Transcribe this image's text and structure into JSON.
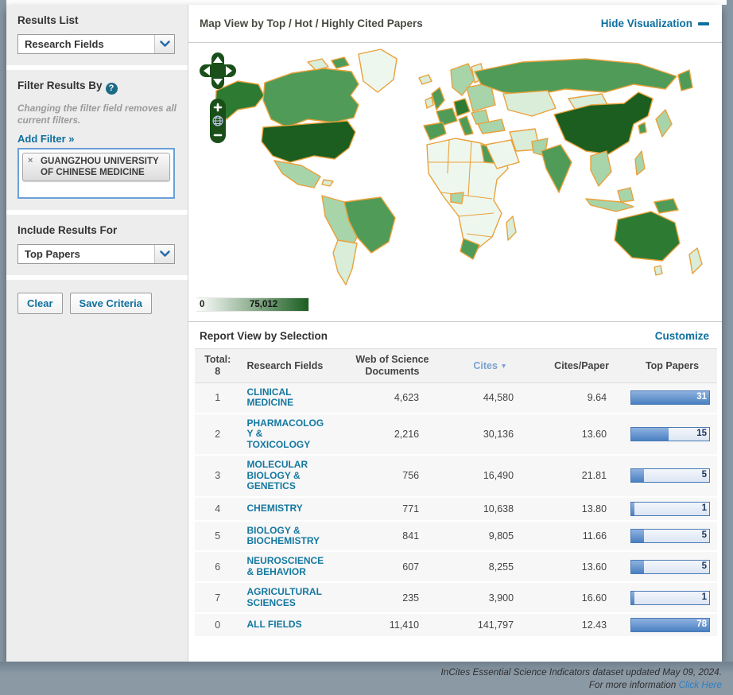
{
  "colors": {
    "link": "#0e6f9e",
    "field-link": "#1578a0",
    "cites-head": "#7aa1d0",
    "bar-border": "#4a7ab5",
    "bar-fill-a": "#8fb2e0",
    "bar-fill-b": "#4a80c2",
    "bar-track-a": "#f3f6fc",
    "bar-track-b": "#dce5f3",
    "bar-label": "#17365d",
    "map-darkest": "#1b5e20",
    "map-dark": "#2d7a33",
    "map-mid": "#4f9b57",
    "map-light": "#a8d4aa",
    "map-pale": "#d9edd9",
    "map-faint": "#eef7ee",
    "map-border": "#e9a13b",
    "control-green": "#1a4f1a",
    "footer-bg": "#8b99a5",
    "sidebar-bg": "#ededed",
    "focus-border": "#6aa0d8"
  },
  "sidebar": {
    "results_list": {
      "heading": "Results List",
      "selected": "Research Fields"
    },
    "filter": {
      "heading": "Filter Results By",
      "help_glyph": "?",
      "note": "Changing the filter field removes all current filters.",
      "add_filter": "Add Filter »",
      "chips": [
        {
          "remove_glyph": "×",
          "label": "GUANGZHOU UNIVERSITY OF CHINESE MEDICINE"
        }
      ]
    },
    "include": {
      "heading": "Include Results For",
      "selected": "Top Papers"
    },
    "buttons": {
      "clear": "Clear",
      "save": "Save Criteria"
    }
  },
  "map": {
    "title": "Map View by Top / Hot / Highly Cited Papers",
    "hide_link": "Hide Visualization",
    "legend": {
      "min": "0",
      "max": "75,012"
    },
    "controls": {
      "zoom_in": "+",
      "zoom_out": "−"
    }
  },
  "report": {
    "title": "Report View by Selection",
    "customize": "Customize",
    "columns": {
      "total_label": "Total:",
      "total_value": "8",
      "research_fields": "Research Fields",
      "docs": "Web of Science Documents",
      "cites": "Cites",
      "sort_indicator": "▼",
      "cites_per_paper": "Cites/Paper",
      "top_papers": "Top Papers"
    },
    "rows": [
      {
        "rank": "1",
        "field": "CLINICAL MEDICINE",
        "docs": "4,623",
        "cites": "44,580",
        "cpp": "9.64",
        "top_papers": "31",
        "bar_pct": 100
      },
      {
        "rank": "2",
        "field": "PHARMACOLOGY & TOXICOLOGY",
        "docs": "2,216",
        "cites": "30,136",
        "cpp": "13.60",
        "top_papers": "15",
        "bar_pct": 48
      },
      {
        "rank": "3",
        "field": "MOLECULAR BIOLOGY & GENETICS",
        "docs": "756",
        "cites": "16,490",
        "cpp": "21.81",
        "top_papers": "5",
        "bar_pct": 16
      },
      {
        "rank": "4",
        "field": "CHEMISTRY",
        "docs": "771",
        "cites": "10,638",
        "cpp": "13.80",
        "top_papers": "1",
        "bar_pct": 4
      },
      {
        "rank": "5",
        "field": "BIOLOGY & BIOCHEMISTRY",
        "docs": "841",
        "cites": "9,805",
        "cpp": "11.66",
        "top_papers": "5",
        "bar_pct": 16
      },
      {
        "rank": "6",
        "field": "NEUROSCIENCE & BEHAVIOR",
        "docs": "607",
        "cites": "8,255",
        "cpp": "13.60",
        "top_papers": "5",
        "bar_pct": 16
      },
      {
        "rank": "7",
        "field": "AGRICULTURAL SCIENCES",
        "docs": "235",
        "cites": "3,900",
        "cpp": "16.60",
        "top_papers": "1",
        "bar_pct": 4
      },
      {
        "rank": "0",
        "field": "ALL FIELDS",
        "docs": "11,410",
        "cites": "141,797",
        "cpp": "12.43",
        "top_papers": "78",
        "bar_pct": 100
      }
    ]
  },
  "footer": {
    "line1": "InCites Essential Science Indicators dataset updated May 09, 2024.",
    "line2_prefix": "For more information",
    "link": "Click Here"
  }
}
